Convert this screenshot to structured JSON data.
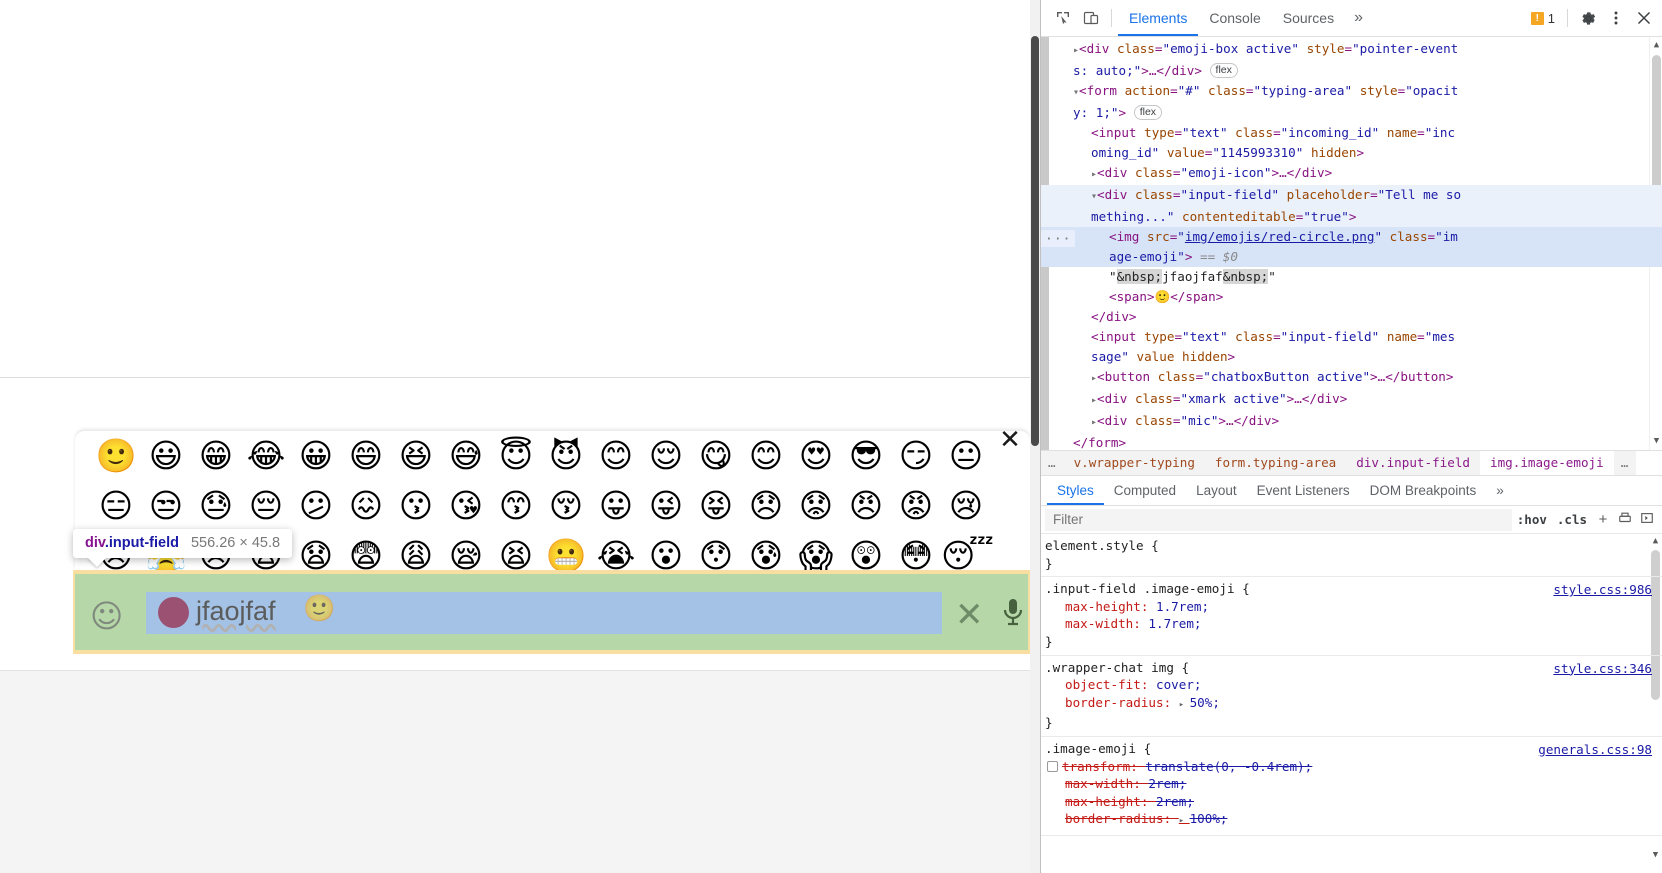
{
  "devtools": {
    "toolbar": {
      "inspect_icon": "inspect-element-icon",
      "device_icon": "device-toolbar-icon",
      "tabs": [
        {
          "label": "Elements",
          "active": true
        },
        {
          "label": "Console",
          "active": false
        },
        {
          "label": "Sources",
          "active": false
        }
      ],
      "more_tabs": "»",
      "warning_count": "1",
      "settings_icon": "gear-icon",
      "kebab_icon": "more-options-icon",
      "close_icon": "close-icon"
    },
    "dom_lines": [
      {
        "indent": 1,
        "tri": "▸",
        "parts": [
          {
            "t": "pun",
            "v": "<"
          },
          {
            "t": "tg",
            "v": "div"
          },
          {
            "t": "sp",
            "v": " "
          },
          {
            "t": "at",
            "v": "class"
          },
          {
            "t": "pun2",
            "v": "="
          },
          {
            "t": "av",
            "v": "\"emoji-box active\""
          },
          {
            "t": "sp",
            "v": " "
          },
          {
            "t": "at",
            "v": "style"
          },
          {
            "t": "pun2",
            "v": "="
          },
          {
            "t": "av",
            "v": "\"pointer-event"
          }
        ]
      },
      {
        "indent": 1,
        "tri": "",
        "parts": [
          {
            "t": "av",
            "v": "s: auto;\""
          },
          {
            "t": "pun",
            "v": ">…</"
          },
          {
            "t": "tg",
            "v": "div"
          },
          {
            "t": "pun",
            "v": ">"
          },
          {
            "t": "sp",
            "v": " "
          },
          {
            "t": "flex",
            "v": "flex"
          }
        ]
      },
      {
        "indent": 1,
        "tri": "▾",
        "parts": [
          {
            "t": "pun",
            "v": "<"
          },
          {
            "t": "tg",
            "v": "form"
          },
          {
            "t": "sp",
            "v": " "
          },
          {
            "t": "at",
            "v": "action"
          },
          {
            "t": "pun2",
            "v": "="
          },
          {
            "t": "av",
            "v": "\"#\""
          },
          {
            "t": "sp",
            "v": " "
          },
          {
            "t": "at",
            "v": "class"
          },
          {
            "t": "pun2",
            "v": "="
          },
          {
            "t": "av",
            "v": "\"typing-area\""
          },
          {
            "t": "sp",
            "v": " "
          },
          {
            "t": "at",
            "v": "style"
          },
          {
            "t": "pun2",
            "v": "="
          },
          {
            "t": "av",
            "v": "\"opacit"
          }
        ]
      },
      {
        "indent": 1,
        "tri": "",
        "parts": [
          {
            "t": "av",
            "v": "y: 1;\""
          },
          {
            "t": "pun",
            "v": ">"
          },
          {
            "t": "sp",
            "v": " "
          },
          {
            "t": "flex",
            "v": "flex"
          }
        ]
      },
      {
        "indent": 2,
        "tri": "",
        "parts": [
          {
            "t": "pun",
            "v": "<"
          },
          {
            "t": "tg",
            "v": "input"
          },
          {
            "t": "sp",
            "v": " "
          },
          {
            "t": "at",
            "v": "type"
          },
          {
            "t": "pun2",
            "v": "="
          },
          {
            "t": "av",
            "v": "\"text\""
          },
          {
            "t": "sp",
            "v": " "
          },
          {
            "t": "at",
            "v": "class"
          },
          {
            "t": "pun2",
            "v": "="
          },
          {
            "t": "av",
            "v": "\"incoming_id\""
          },
          {
            "t": "sp",
            "v": " "
          },
          {
            "t": "at",
            "v": "name"
          },
          {
            "t": "pun2",
            "v": "="
          },
          {
            "t": "av",
            "v": "\"inc"
          }
        ]
      },
      {
        "indent": 2,
        "tri": "",
        "parts": [
          {
            "t": "av",
            "v": "oming_id\""
          },
          {
            "t": "sp",
            "v": " "
          },
          {
            "t": "at",
            "v": "value"
          },
          {
            "t": "pun2",
            "v": "="
          },
          {
            "t": "av",
            "v": "\"1145993310\""
          },
          {
            "t": "sp",
            "v": " "
          },
          {
            "t": "at",
            "v": "hidden"
          },
          {
            "t": "pun",
            "v": ">"
          }
        ]
      },
      {
        "indent": 2,
        "tri": "▸",
        "parts": [
          {
            "t": "pun",
            "v": "<"
          },
          {
            "t": "tg",
            "v": "div"
          },
          {
            "t": "sp",
            "v": " "
          },
          {
            "t": "at",
            "v": "class"
          },
          {
            "t": "pun2",
            "v": "="
          },
          {
            "t": "av",
            "v": "\"emoji-icon\""
          },
          {
            "t": "pun",
            "v": ">…</"
          },
          {
            "t": "tg",
            "v": "div"
          },
          {
            "t": "pun",
            "v": ">"
          }
        ]
      },
      {
        "indent": 2,
        "tri": "▾",
        "hl": "light",
        "parts": [
          {
            "t": "pun",
            "v": "<"
          },
          {
            "t": "tg",
            "v": "div"
          },
          {
            "t": "sp",
            "v": " "
          },
          {
            "t": "at",
            "v": "class"
          },
          {
            "t": "pun2",
            "v": "="
          },
          {
            "t": "av",
            "v": "\"input-field\""
          },
          {
            "t": "sp",
            "v": " "
          },
          {
            "t": "at",
            "v": "placeholder"
          },
          {
            "t": "pun2",
            "v": "="
          },
          {
            "t": "av",
            "v": "\"Tell me so"
          }
        ]
      },
      {
        "indent": 2,
        "tri": "",
        "hl": "light",
        "parts": [
          {
            "t": "av",
            "v": "mething...\""
          },
          {
            "t": "sp",
            "v": " "
          },
          {
            "t": "at",
            "v": "contenteditable"
          },
          {
            "t": "pun2",
            "v": "="
          },
          {
            "t": "av",
            "v": "\"true\""
          },
          {
            "t": "pun",
            "v": ">"
          }
        ]
      },
      {
        "indent": 3,
        "tri": "",
        "hl": "strong",
        "dots": true,
        "parts": [
          {
            "t": "pun",
            "v": "<"
          },
          {
            "t": "tg",
            "v": "img"
          },
          {
            "t": "sp",
            "v": " "
          },
          {
            "t": "at",
            "v": "src"
          },
          {
            "t": "pun2",
            "v": "="
          },
          {
            "t": "av",
            "v": "\""
          },
          {
            "t": "lnk",
            "v": "img/emojis/red-circle.png"
          },
          {
            "t": "av",
            "v": "\""
          },
          {
            "t": "sp",
            "v": " "
          },
          {
            "t": "at",
            "v": "class"
          },
          {
            "t": "pun2",
            "v": "="
          },
          {
            "t": "av",
            "v": "\"im"
          }
        ]
      },
      {
        "indent": 3,
        "tri": "",
        "hl": "strong",
        "parts": [
          {
            "t": "av",
            "v": "age-emoji\""
          },
          {
            "t": "pun",
            "v": ">"
          },
          {
            "t": "sp",
            "v": " "
          },
          {
            "t": "dollar",
            "v": "== $0"
          }
        ]
      },
      {
        "indent": 3,
        "tri": "",
        "parts": [
          {
            "t": "tx",
            "v": "\""
          },
          {
            "t": "nbsp",
            "v": "&nbsp;"
          },
          {
            "t": "tx",
            "v": "jfaojfaf"
          },
          {
            "t": "nbsp",
            "v": "&nbsp;"
          },
          {
            "t": "tx",
            "v": "\""
          }
        ]
      },
      {
        "indent": 3,
        "tri": "",
        "parts": [
          {
            "t": "pun",
            "v": "<"
          },
          {
            "t": "tg",
            "v": "span"
          },
          {
            "t": "pun",
            "v": ">"
          },
          {
            "t": "emoji",
            "v": "🙂"
          },
          {
            "t": "pun",
            "v": "</"
          },
          {
            "t": "tg",
            "v": "span"
          },
          {
            "t": "pun",
            "v": ">"
          }
        ]
      },
      {
        "indent": 2,
        "tri": "",
        "parts": [
          {
            "t": "pun",
            "v": "</"
          },
          {
            "t": "tg",
            "v": "div"
          },
          {
            "t": "pun",
            "v": ">"
          }
        ]
      },
      {
        "indent": 2,
        "tri": "",
        "parts": [
          {
            "t": "pun",
            "v": "<"
          },
          {
            "t": "tg",
            "v": "input"
          },
          {
            "t": "sp",
            "v": " "
          },
          {
            "t": "at",
            "v": "type"
          },
          {
            "t": "pun2",
            "v": "="
          },
          {
            "t": "av",
            "v": "\"text\""
          },
          {
            "t": "sp",
            "v": " "
          },
          {
            "t": "at",
            "v": "class"
          },
          {
            "t": "pun2",
            "v": "="
          },
          {
            "t": "av",
            "v": "\"input-field\""
          },
          {
            "t": "sp",
            "v": " "
          },
          {
            "t": "at",
            "v": "name"
          },
          {
            "t": "pun2",
            "v": "="
          },
          {
            "t": "av",
            "v": "\"mes"
          }
        ]
      },
      {
        "indent": 2,
        "tri": "",
        "parts": [
          {
            "t": "av",
            "v": "sage\""
          },
          {
            "t": "sp",
            "v": " "
          },
          {
            "t": "at",
            "v": "value"
          },
          {
            "t": "sp",
            "v": " "
          },
          {
            "t": "at",
            "v": "hidden"
          },
          {
            "t": "pun",
            "v": ">"
          }
        ]
      },
      {
        "indent": 2,
        "tri": "▸",
        "parts": [
          {
            "t": "pun",
            "v": "<"
          },
          {
            "t": "tg",
            "v": "button"
          },
          {
            "t": "sp",
            "v": " "
          },
          {
            "t": "at",
            "v": "class"
          },
          {
            "t": "pun2",
            "v": "="
          },
          {
            "t": "av",
            "v": "\"chatboxButton active\""
          },
          {
            "t": "pun",
            "v": ">…</"
          },
          {
            "t": "tg",
            "v": "button"
          },
          {
            "t": "pun",
            "v": ">"
          }
        ]
      },
      {
        "indent": 2,
        "tri": "▸",
        "parts": [
          {
            "t": "pun",
            "v": "<"
          },
          {
            "t": "tg",
            "v": "div"
          },
          {
            "t": "sp",
            "v": " "
          },
          {
            "t": "at",
            "v": "class"
          },
          {
            "t": "pun2",
            "v": "="
          },
          {
            "t": "av",
            "v": "\"xmark active\""
          },
          {
            "t": "pun",
            "v": ">…</"
          },
          {
            "t": "tg",
            "v": "div"
          },
          {
            "t": "pun",
            "v": ">"
          }
        ]
      },
      {
        "indent": 2,
        "tri": "▸",
        "parts": [
          {
            "t": "pun",
            "v": "<"
          },
          {
            "t": "tg",
            "v": "div"
          },
          {
            "t": "sp",
            "v": " "
          },
          {
            "t": "at",
            "v": "class"
          },
          {
            "t": "pun2",
            "v": "="
          },
          {
            "t": "av",
            "v": "\"mic\""
          },
          {
            "t": "pun",
            "v": ">…</"
          },
          {
            "t": "tg",
            "v": "div"
          },
          {
            "t": "pun",
            "v": ">"
          }
        ]
      },
      {
        "indent": 1,
        "tri": "",
        "parts": [
          {
            "t": "pun",
            "v": "</"
          },
          {
            "t": "tg",
            "v": "form"
          },
          {
            "t": "pun",
            "v": ">"
          }
        ]
      }
    ],
    "breadcrumbs": [
      {
        "label": "…",
        "kind": "dots"
      },
      {
        "label": "v.wrapper-typing",
        "kind": "c1"
      },
      {
        "label": "form.typing-area",
        "kind": "c2"
      },
      {
        "label": "div.input-field",
        "kind": "c3"
      },
      {
        "label": "img.image-emoji",
        "kind": "active"
      },
      {
        "label": "…",
        "kind": "dots"
      }
    ],
    "styles_tabs": [
      {
        "label": "Styles",
        "active": true
      },
      {
        "label": "Computed",
        "active": false
      },
      {
        "label": "Layout",
        "active": false
      },
      {
        "label": "Event Listeners",
        "active": false
      },
      {
        "label": "DOM Breakpoints",
        "active": false
      },
      {
        "label": "»",
        "active": false
      }
    ],
    "filter": {
      "placeholder": "Filter",
      "value": "",
      "hov_label": ":hov",
      "cls_label": ".cls",
      "new_rule_icon": "add-style-rule-icon",
      "print_icon": "print-media-icon",
      "sidebar_icon": "toggle-sidebar-icon"
    },
    "rules": [
      {
        "selector": "element.style {",
        "source": "",
        "declarations": [],
        "close": "}"
      },
      {
        "selector": ".input-field .image-emoji {",
        "source": "style.css:986",
        "declarations": [
          {
            "name": "max-height",
            "value": "1.7rem;",
            "strike": false,
            "checkbox": false,
            "swatch": false
          },
          {
            "name": "max-width",
            "value": "1.7rem;",
            "strike": false,
            "checkbox": false,
            "swatch": false
          }
        ],
        "close": "}"
      },
      {
        "selector": ".wrapper-chat img {",
        "source": "style.css:346",
        "declarations": [
          {
            "name": "object-fit",
            "value": "cover;",
            "strike": false,
            "checkbox": false,
            "swatch": false
          },
          {
            "name": "border-radius",
            "value": "50%;",
            "strike": false,
            "checkbox": false,
            "swatch": true
          }
        ],
        "close": "}"
      },
      {
        "selector": ".image-emoji {",
        "source": "generals.css:98",
        "declarations": [
          {
            "name": "transform",
            "value": "translate(0, -0.4rem);",
            "strike": true,
            "checkbox": true,
            "swatch": false
          },
          {
            "name": "max-width",
            "value": "2rem;",
            "strike": true,
            "checkbox": false,
            "swatch": false
          },
          {
            "name": "max-height",
            "value": "2rem;",
            "strike": true,
            "checkbox": false,
            "swatch": false
          },
          {
            "name": "border-radius",
            "value": "100%;",
            "strike": true,
            "checkbox": false,
            "swatch": true
          }
        ],
        "close": ""
      }
    ]
  },
  "page": {
    "emoji_panel": {
      "close_icon": "✕",
      "rows": [
        [
          "🙂",
          "😃",
          "😁",
          "😂",
          "😀",
          "😄",
          "😆",
          "😅",
          "😇",
          "😈",
          "😊",
          "😌",
          "😋",
          "😊",
          "😍",
          "😎",
          "😏",
          "😐"
        ],
        [
          "😑",
          "😒",
          "😓",
          "😔",
          "😕",
          "😖",
          "😗",
          "😘",
          "😙",
          "😚",
          "😛",
          "😜",
          "😝",
          "😞",
          "😟",
          "😠",
          "😡",
          "😢"
        ],
        [
          "😣",
          "😤",
          "😥",
          "😦",
          "😧",
          "😨",
          "😩",
          "😪",
          "😫",
          "😬",
          "😭",
          "😮",
          "😯",
          "😰",
          "😱",
          "😲",
          "😳",
          "😴"
        ]
      ]
    },
    "inspect_tooltip": {
      "tag": "div",
      "cls": ".input-field",
      "dimensions": "556.26 × 45.8"
    },
    "typing_area": {
      "emoji_button_icon": "☺",
      "input_text": "jfaojfaf",
      "input_trailing_emoji": "🙂",
      "red_circle_icon": "red-circle-emoji",
      "xmark_icon": "✕",
      "mic_icon": "🎙"
    }
  }
}
